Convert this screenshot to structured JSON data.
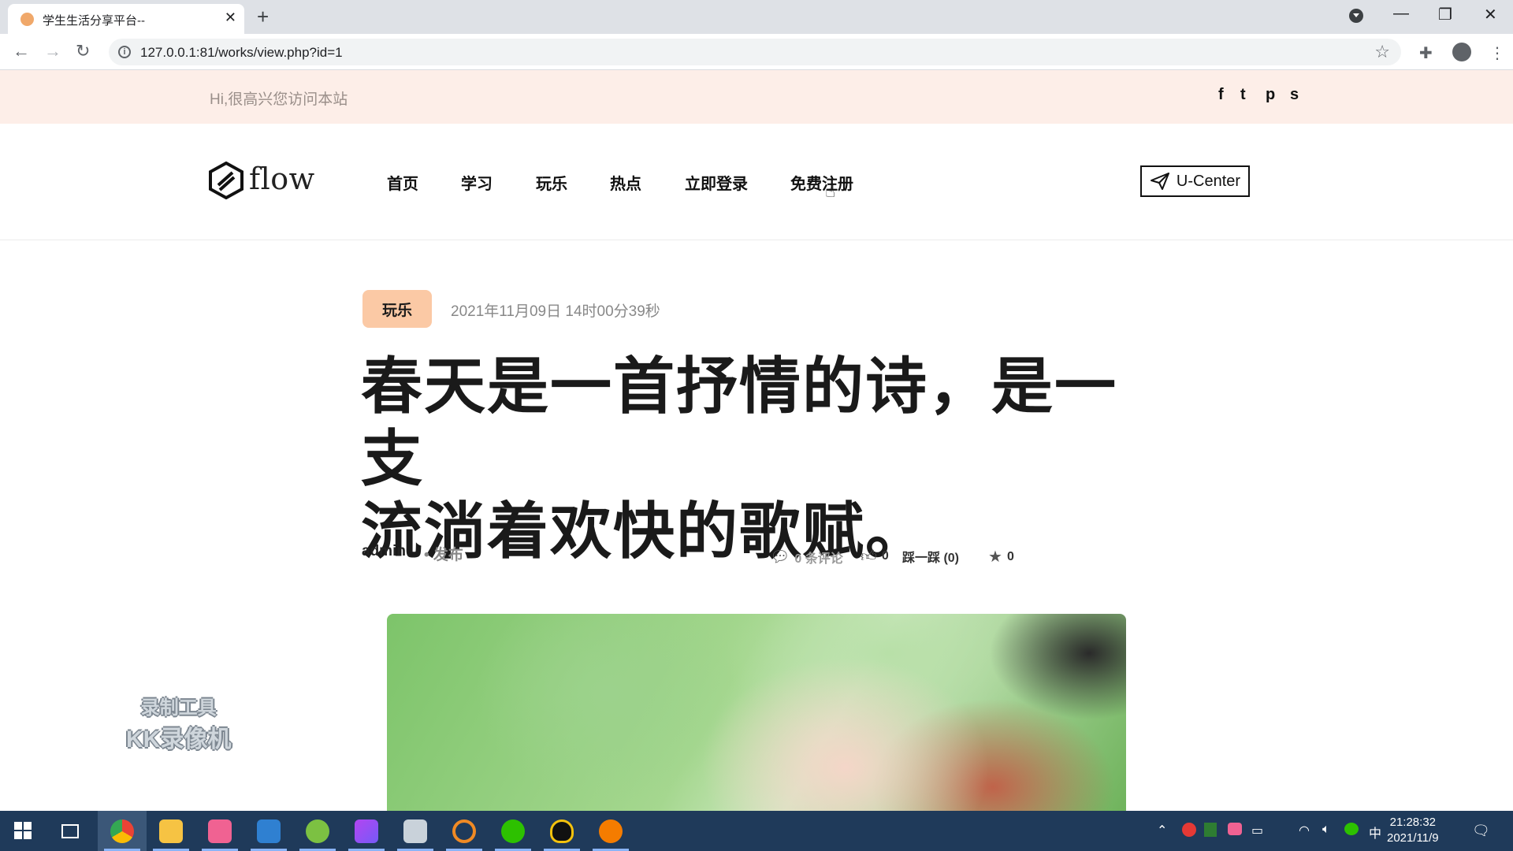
{
  "browser": {
    "tab_title": "学生生活分享平台--",
    "tab_close": "✕",
    "new_tab": "+",
    "url": "127.0.0.1:81/works/view.php?id=1"
  },
  "topbar": {
    "greeting": "Hi,很高兴您访问本站",
    "social": [
      "f",
      "t",
      "p",
      "s"
    ]
  },
  "header": {
    "logo_text": "flow",
    "nav": [
      "首页",
      "学习",
      "玩乐",
      "热点",
      "立即登录",
      "免费注册"
    ],
    "ucenter_label": "U-Center"
  },
  "article": {
    "category": "玩乐",
    "date": "2021年11月09日 14时00分39秒",
    "title_line1": "春天是一首抒情的诗，是一支",
    "title_line2": "流淌着欢快的歌赋。",
    "author": "admin",
    "publish": "• 发布",
    "comments": "0 条评论",
    "likes": "0",
    "dislike": "踩一踩 (0)",
    "favorites": "0"
  },
  "watermark": {
    "line1": "录制工具",
    "line2": "KK录像机"
  },
  "taskbar": {
    "time": "21:28:32",
    "date": "2021/11/9",
    "ime": "中"
  },
  "colors": {
    "topbar_bg": "#fdeee8",
    "badge_bg": "#fbc9a5",
    "taskbar_bg": "#1f3a5a"
  }
}
